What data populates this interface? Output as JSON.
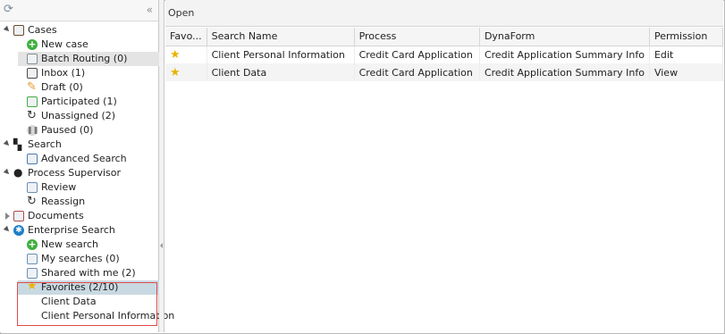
{
  "left_panel": {
    "collapse_glyph": "«",
    "refresh_glyph": "⟳",
    "tree": [
      {
        "id": "cases",
        "label": "Cases",
        "toggle": "open",
        "icon": "briefcase-icon",
        "color": "#6b4a2a"
      },
      {
        "id": "new-case",
        "label": "New case",
        "icon": "plus-circle-icon",
        "color": "#3fae3f"
      },
      {
        "id": "batch-routing",
        "label": "Batch Routing (0)",
        "icon": "batch-icon",
        "color": "#8a8a8a",
        "selected": true
      },
      {
        "id": "inbox",
        "label": "Inbox (1)",
        "icon": "inbox-icon",
        "color": "#4a4a4a"
      },
      {
        "id": "draft",
        "label": "Draft (0)",
        "icon": "pencil-icon",
        "color": "#e39a2d"
      },
      {
        "id": "participated",
        "label": "Participated (1)",
        "icon": "participated-icon",
        "color": "#3fae3f"
      },
      {
        "id": "unassigned",
        "label": "Unassigned (2)",
        "icon": "unassigned-icon",
        "color": "#333"
      },
      {
        "id": "paused",
        "label": "Paused (0)",
        "icon": "pause-icon",
        "color": "#9a9a9a"
      },
      {
        "id": "search",
        "label": "Search",
        "toggle": "open",
        "icon": "binoculars-icon",
        "color": "#222"
      },
      {
        "id": "advanced-search",
        "label": "Advanced Search",
        "icon": "advanced-search-icon",
        "color": "#4a7ab0"
      },
      {
        "id": "process-supervisor",
        "label": "Process Supervisor",
        "toggle": "open",
        "icon": "user-icon",
        "color": "#222"
      },
      {
        "id": "review",
        "label": "Review",
        "icon": "review-icon",
        "color": "#6a8fb5"
      },
      {
        "id": "reassign",
        "label": "Reassign",
        "icon": "reassign-icon",
        "color": "#333"
      },
      {
        "id": "documents",
        "label": "Documents",
        "toggle": "closed",
        "icon": "documents-icon",
        "color": "#b04a4a"
      },
      {
        "id": "enterprise-search",
        "label": "Enterprise Search",
        "toggle": "open",
        "icon": "gear-icon",
        "color": "#1f7fc4"
      },
      {
        "id": "new-search",
        "label": "New search",
        "icon": "plus-circle-icon",
        "color": "#3fae3f"
      },
      {
        "id": "my-searches",
        "label": "My searches (0)",
        "icon": "list-icon",
        "color": "#6a8fb5"
      },
      {
        "id": "shared-with-me",
        "label": "Shared with me (2)",
        "icon": "shared-icon",
        "color": "#6a8fb5"
      },
      {
        "id": "favorites",
        "label": "Favorites (2/10)",
        "icon": "star-icon",
        "color": "#e8b400",
        "favselected": true
      },
      {
        "id": "client-data",
        "label": "Client Data"
      },
      {
        "id": "client-personal-information",
        "label": "Client Personal Information"
      }
    ]
  },
  "toolbar": {
    "open_label": "Open"
  },
  "grid": {
    "columns": [
      "Favo...",
      "Search Name",
      "Process",
      "DynaForm",
      "Permission"
    ],
    "rows": [
      {
        "favorite": true,
        "search_name": "Client Personal Information",
        "process": "Credit Card Application",
        "dynaform": "Credit Application Summary Info",
        "permission": "Edit"
      },
      {
        "favorite": true,
        "search_name": "Client Data",
        "process": "Credit Card Application",
        "dynaform": "Credit Application Summary Info",
        "permission": "View"
      }
    ]
  },
  "colors": {
    "highlight_border": "#e04a4a",
    "favorites_selection": "#c9d9e2",
    "star": "#e8b400"
  }
}
